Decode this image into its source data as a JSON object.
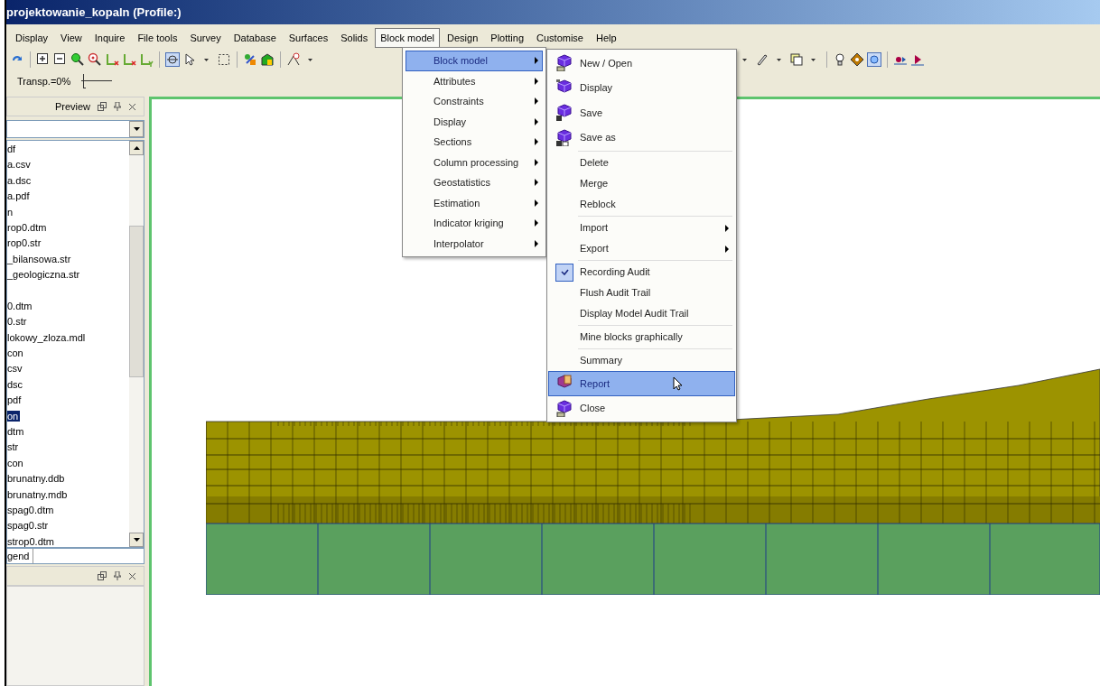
{
  "window": {
    "title": "projektowanie_kopaln (Profile:)"
  },
  "menubar": [
    {
      "label": "Display",
      "selected": false
    },
    {
      "label": "View",
      "selected": false
    },
    {
      "label": "Inquire",
      "selected": false
    },
    {
      "label": "File tools",
      "selected": false
    },
    {
      "label": "Survey",
      "selected": false
    },
    {
      "label": "Database",
      "selected": false
    },
    {
      "label": "Surfaces",
      "selected": false
    },
    {
      "label": "Solids",
      "selected": false
    },
    {
      "label": "Block model",
      "selected": true
    },
    {
      "label": "Design",
      "selected": false
    },
    {
      "label": "Plotting",
      "selected": false
    },
    {
      "label": "Customise",
      "selected": false
    },
    {
      "label": "Help",
      "selected": false
    }
  ],
  "toolbar2": {
    "transparency_label": "Transp.=0%",
    "level": 0.05
  },
  "left_panel": {
    "tab": "Preview",
    "files": [
      {
        "name": "df",
        "selected": false
      },
      {
        "name": "a.csv",
        "selected": false
      },
      {
        "name": "a.dsc",
        "selected": false
      },
      {
        "name": "a.pdf",
        "selected": false
      },
      {
        "name": "n",
        "selected": false
      },
      {
        "name": "rop0.dtm",
        "selected": false
      },
      {
        "name": "rop0.str",
        "selected": false
      },
      {
        "name": "_bilansowa.str",
        "selected": false
      },
      {
        "name": "_geologiczna.str",
        "selected": false
      },
      {
        "name": "0.dtm",
        "selected": false,
        "gap_before": true
      },
      {
        "name": "0.str",
        "selected": false
      },
      {
        "name": "lokowy_zloza.mdl",
        "selected": false
      },
      {
        "name": "con",
        "selected": false
      },
      {
        "name": "csv",
        "selected": false
      },
      {
        "name": "dsc",
        "selected": false
      },
      {
        "name": "pdf",
        "selected": false
      },
      {
        "name": "on",
        "selected": true
      },
      {
        "name": "dtm",
        "selected": false
      },
      {
        "name": "str",
        "selected": false
      },
      {
        "name": "con",
        "selected": false
      },
      {
        "name": "brunatny.ddb",
        "selected": false
      },
      {
        "name": "brunatny.mdb",
        "selected": false
      },
      {
        "name": "spag0.dtm",
        "selected": false
      },
      {
        "name": "spag0.str",
        "selected": false
      },
      {
        "name": "strop0.dtm",
        "selected": false
      }
    ],
    "legend_value": "gend"
  },
  "menu": [
    {
      "label": "Block model",
      "selected": true
    },
    {
      "label": "Attributes",
      "selected": false
    },
    {
      "label": "Constraints",
      "selected": false
    },
    {
      "label": "Display",
      "selected": false
    },
    {
      "label": "Sections",
      "selected": false
    },
    {
      "label": "Column processing",
      "selected": false
    },
    {
      "label": "Geostatistics",
      "selected": false
    },
    {
      "label": "Estimation",
      "selected": false
    },
    {
      "label": "Indicator kriging",
      "selected": false
    },
    {
      "label": "Interpolator",
      "selected": false
    }
  ],
  "submenu": [
    {
      "label": "New / Open",
      "kind": "icon",
      "selected": false
    },
    {
      "label": "Display",
      "kind": "icon",
      "selected": false
    },
    {
      "label": "Save",
      "kind": "icon",
      "selected": false
    },
    {
      "label": "Save as",
      "kind": "icon",
      "selected": false
    },
    {
      "label": "Delete",
      "kind": "plain",
      "selected": false,
      "separator_before": true
    },
    {
      "label": "Merge",
      "kind": "plain",
      "selected": false
    },
    {
      "label": "Reblock",
      "kind": "plain",
      "selected": false
    },
    {
      "label": "Import",
      "kind": "submenu",
      "selected": false,
      "separator_before": true
    },
    {
      "label": "Export",
      "kind": "submenu",
      "selected": false
    },
    {
      "label": "Recording Audit",
      "kind": "check",
      "checked": true,
      "selected": false,
      "separator_before": true
    },
    {
      "label": "Flush Audit Trail",
      "kind": "plain",
      "selected": false
    },
    {
      "label": "Display Model Audit Trail",
      "kind": "plain",
      "selected": false
    },
    {
      "label": "Mine blocks graphically",
      "kind": "plain",
      "selected": false,
      "separator_before": true
    },
    {
      "label": "Summary",
      "kind": "plain",
      "selected": false,
      "separator_before": true
    },
    {
      "label": "Report",
      "kind": "icon",
      "selected": true
    },
    {
      "label": "Close",
      "kind": "icon",
      "selected": false
    }
  ]
}
